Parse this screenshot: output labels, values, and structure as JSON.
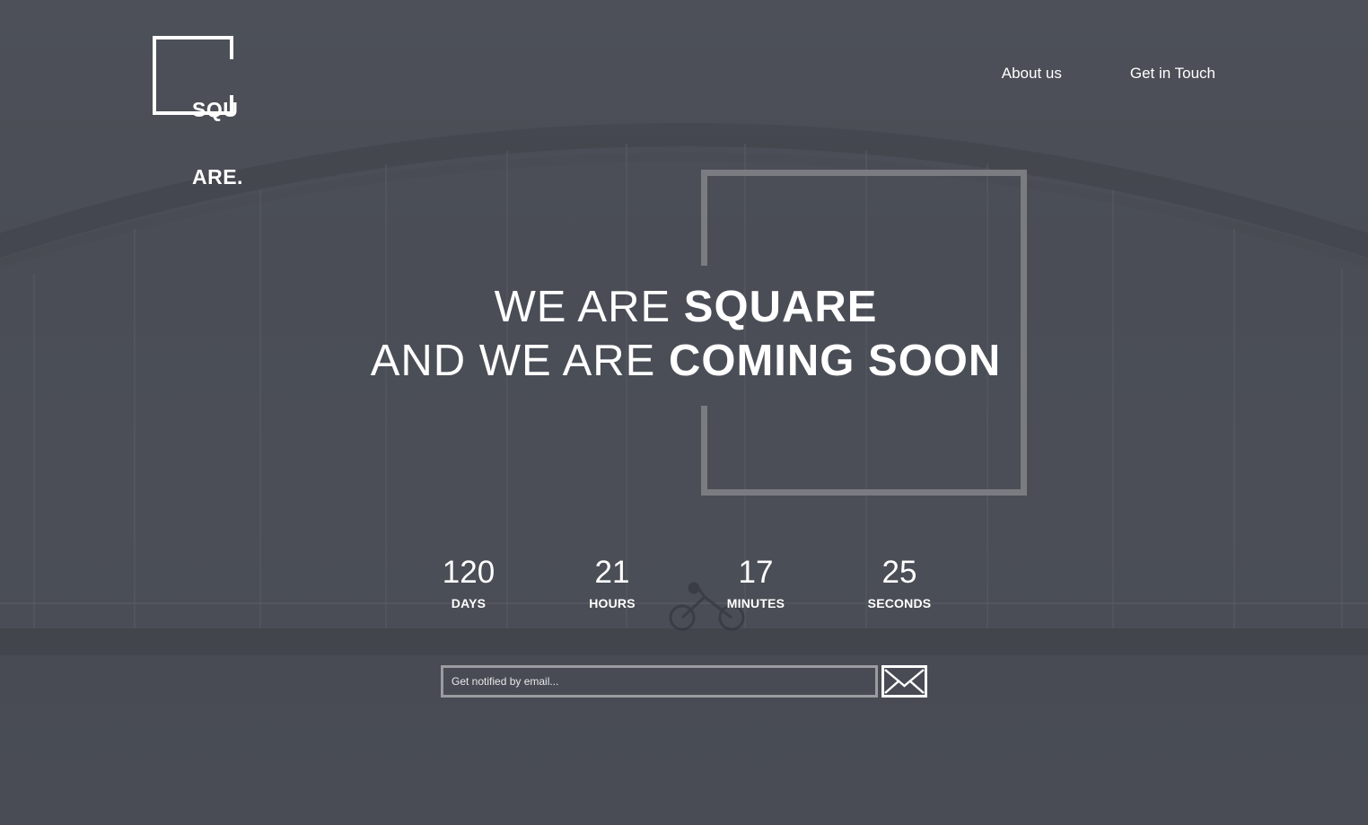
{
  "logo": {
    "line1": "SQU",
    "line2": "ARE."
  },
  "nav": {
    "items": [
      {
        "label": "About us"
      },
      {
        "label": "Get in Touch"
      }
    ]
  },
  "headline": {
    "line1_light": "WE ARE ",
    "line1_bold": "SQUARE",
    "line2_light": "AND WE ARE ",
    "line2_bold": "COMING SOON"
  },
  "countdown": [
    {
      "value": "120",
      "label": "DAYS"
    },
    {
      "value": "21",
      "label": "HOURS"
    },
    {
      "value": "17",
      "label": "MINUTES"
    },
    {
      "value": "25",
      "label": "SECONDS"
    }
  ],
  "email": {
    "placeholder": "Get notified by email...",
    "value": ""
  },
  "icons": {
    "submit": "envelope-icon"
  },
  "colors": {
    "background": "#4b4e56",
    "text": "#ffffff",
    "frame": "#7a7c82"
  }
}
